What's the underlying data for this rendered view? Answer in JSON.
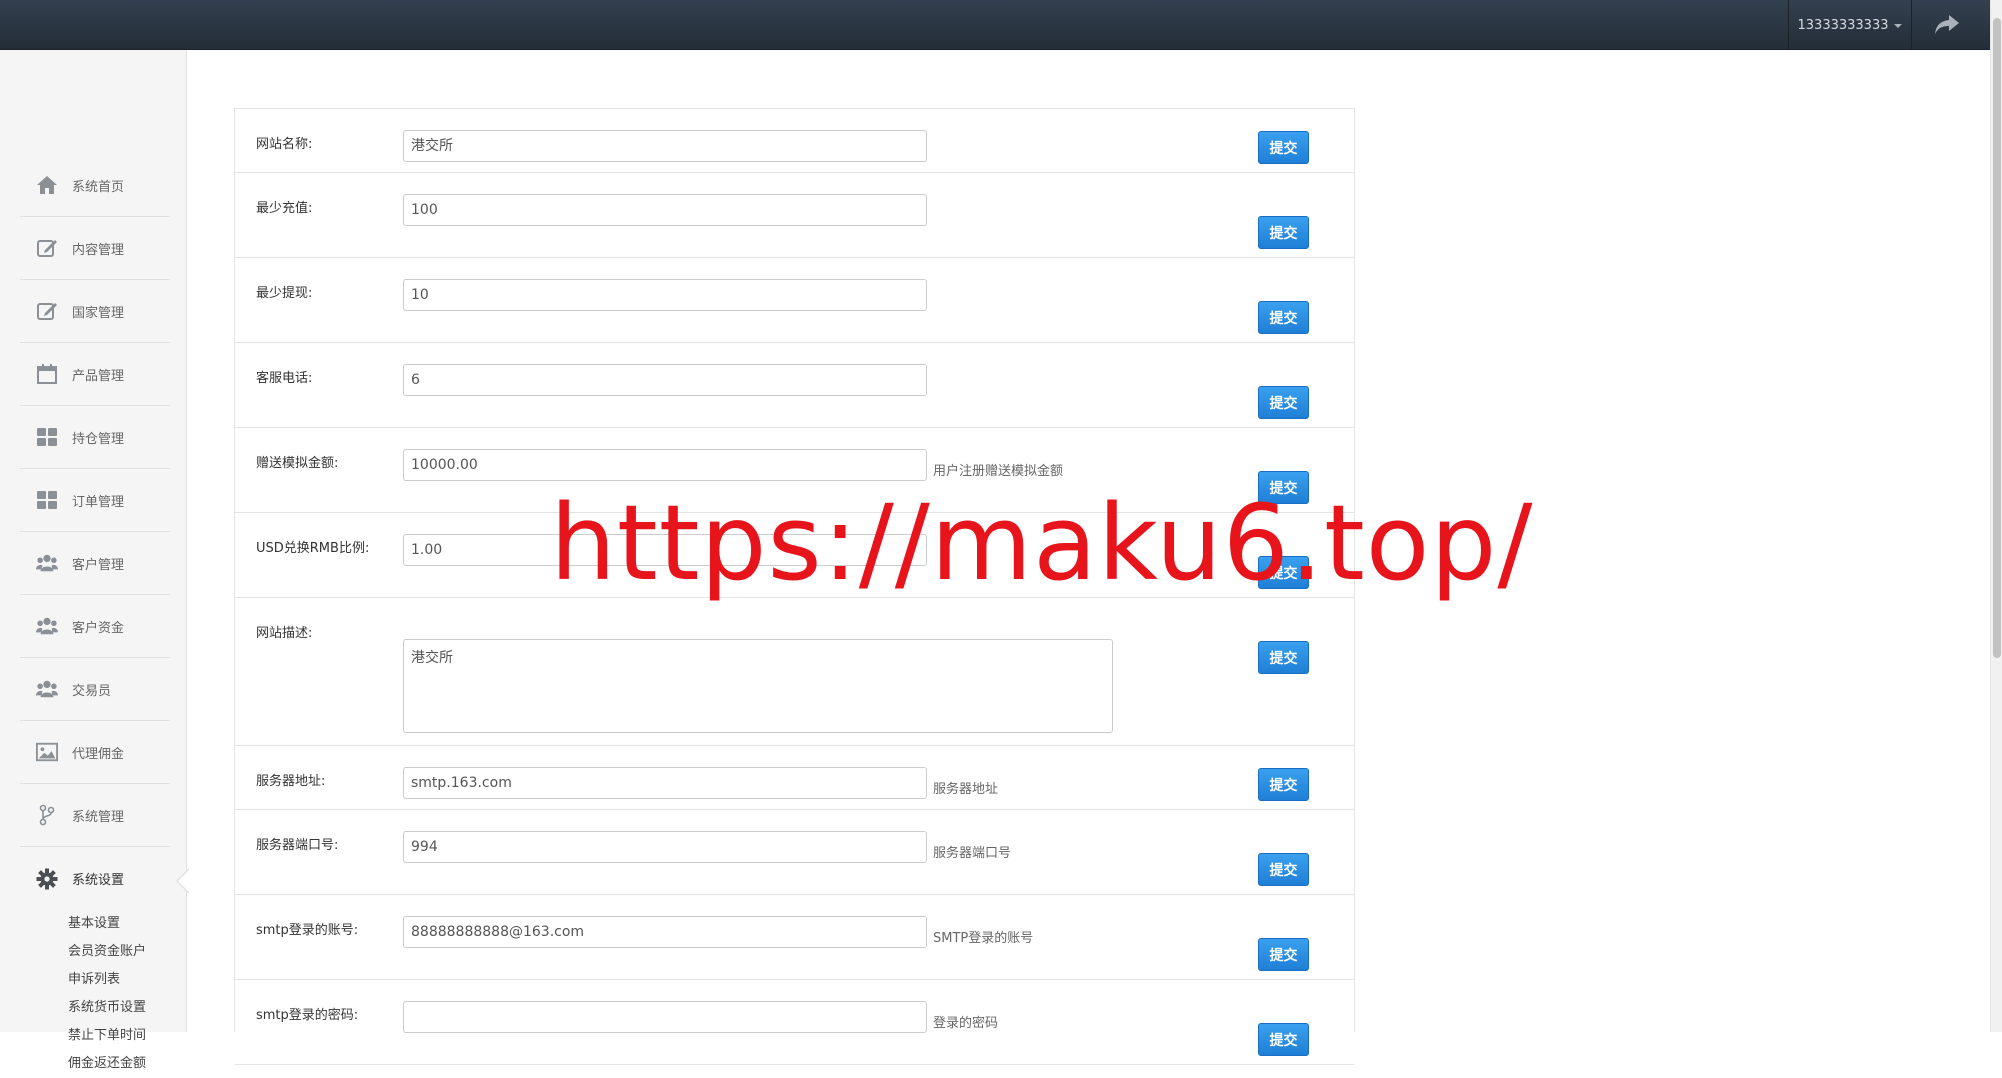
{
  "header": {
    "username": "13333333333",
    "share_icon": "share-icon"
  },
  "sidebar": {
    "items": [
      {
        "label": "系统首页",
        "icon": "home-icon"
      },
      {
        "label": "内容管理",
        "icon": "edit-icon"
      },
      {
        "label": "国家管理",
        "icon": "edit-icon"
      },
      {
        "label": "产品管理",
        "icon": "calendar-icon"
      },
      {
        "label": "持仓管理",
        "icon": "grid-icon"
      },
      {
        "label": "订单管理",
        "icon": "grid-icon"
      },
      {
        "label": "客户管理",
        "icon": "users-icon"
      },
      {
        "label": "客户资金",
        "icon": "users-icon"
      },
      {
        "label": "交易员",
        "icon": "users-icon"
      },
      {
        "label": "代理佣金",
        "icon": "image-icon"
      },
      {
        "label": "系统管理",
        "icon": "branch-icon"
      },
      {
        "label": "系统设置",
        "icon": "gear-icon"
      }
    ],
    "submenu": [
      "基本设置",
      "会员资金账户",
      "申诉列表",
      "系统货币设置",
      "禁止下单时间",
      "佣金返还金额"
    ]
  },
  "form": {
    "submit_label": "提交",
    "rows": [
      {
        "label": "网站名称:",
        "value": "港交所",
        "hint": ""
      },
      {
        "label": "最少充值:",
        "value": "100",
        "hint": ""
      },
      {
        "label": "最少提现:",
        "value": "10",
        "hint": ""
      },
      {
        "label": "客服电话:",
        "value": "6",
        "hint": ""
      },
      {
        "label": "赠送模拟金额:",
        "value": "10000.00",
        "hint": "用户注册赠送模拟金额"
      },
      {
        "label": "USD兑换RMB比例:",
        "value": "1.00",
        "hint": ""
      },
      {
        "label": "网站描述:",
        "value": "港交所",
        "hint": ""
      },
      {
        "label": "服务器地址:",
        "value": "smtp.163.com",
        "hint": "服务器地址"
      },
      {
        "label": "服务器端口号:",
        "value": "994",
        "hint": "服务器端口号"
      },
      {
        "label": "smtp登录的账号:",
        "value": "88888888888@163.com",
        "hint": "SMTP登录的账号"
      },
      {
        "label": "smtp登录的密码:",
        "value": "",
        "hint": "登录的密码"
      }
    ]
  },
  "watermark": "https://maku6.top/",
  "colors": {
    "accent": "#1f7fd6",
    "topbar": "#2b3540",
    "watermark": "#e8141c"
  }
}
